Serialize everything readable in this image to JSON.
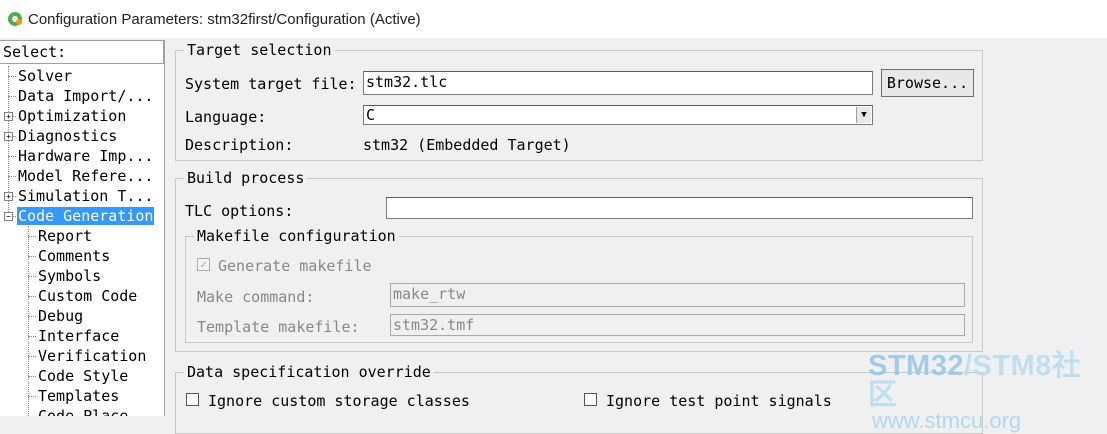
{
  "window": {
    "title": "Configuration Parameters: stm32first/Configuration (Active)"
  },
  "tree": {
    "header": "Select:",
    "items": [
      {
        "label": "Solver",
        "level": 0,
        "expander": ""
      },
      {
        "label": "Data Import/...",
        "level": 0,
        "expander": ""
      },
      {
        "label": "Optimization",
        "level": 0,
        "expander": "+"
      },
      {
        "label": "Diagnostics",
        "level": 0,
        "expander": "+"
      },
      {
        "label": "Hardware Imp...",
        "level": 0,
        "expander": ""
      },
      {
        "label": "Model Refere...",
        "level": 0,
        "expander": ""
      },
      {
        "label": "Simulation T...",
        "level": 0,
        "expander": "+"
      },
      {
        "label": "Code Generation",
        "level": 0,
        "expander": "-",
        "selected": true
      },
      {
        "label": "Report",
        "level": 1
      },
      {
        "label": "Comments",
        "level": 1
      },
      {
        "label": "Symbols",
        "level": 1
      },
      {
        "label": "Custom Code",
        "level": 1
      },
      {
        "label": "Debug",
        "level": 1
      },
      {
        "label": "Interface",
        "level": 1
      },
      {
        "label": "Verification",
        "level": 1
      },
      {
        "label": "Code Style",
        "level": 1
      },
      {
        "label": "Templates",
        "level": 1
      },
      {
        "label": "Code Place...",
        "level": 1
      }
    ]
  },
  "target_selection": {
    "title": "Target selection",
    "system_target_label": "System target file:",
    "system_target_value": "stm32.tlc",
    "browse_label": "Browse...",
    "language_label": "Language:",
    "language_value": "C",
    "description_label": "Description:",
    "description_value": "stm32 (Embedded Target)"
  },
  "build_process": {
    "title": "Build process",
    "tlc_label": "TLC options:",
    "tlc_value": "",
    "makefile": {
      "title": "Makefile configuration",
      "generate_label": "Generate makefile",
      "generate_checked": true,
      "make_command_label": "Make command:",
      "make_command_value": "make_rtw",
      "template_label": "Template makefile:",
      "template_value": "stm32.tmf"
    }
  },
  "data_spec": {
    "title": "Data specification override",
    "ignore_storage_label": "Ignore custom storage classes",
    "ignore_testpoint_label": "Ignore test point signals"
  },
  "watermark": {
    "line1a": "STM32",
    "line1b": "/STM8社区",
    "line2": "www.stmcu.org"
  }
}
